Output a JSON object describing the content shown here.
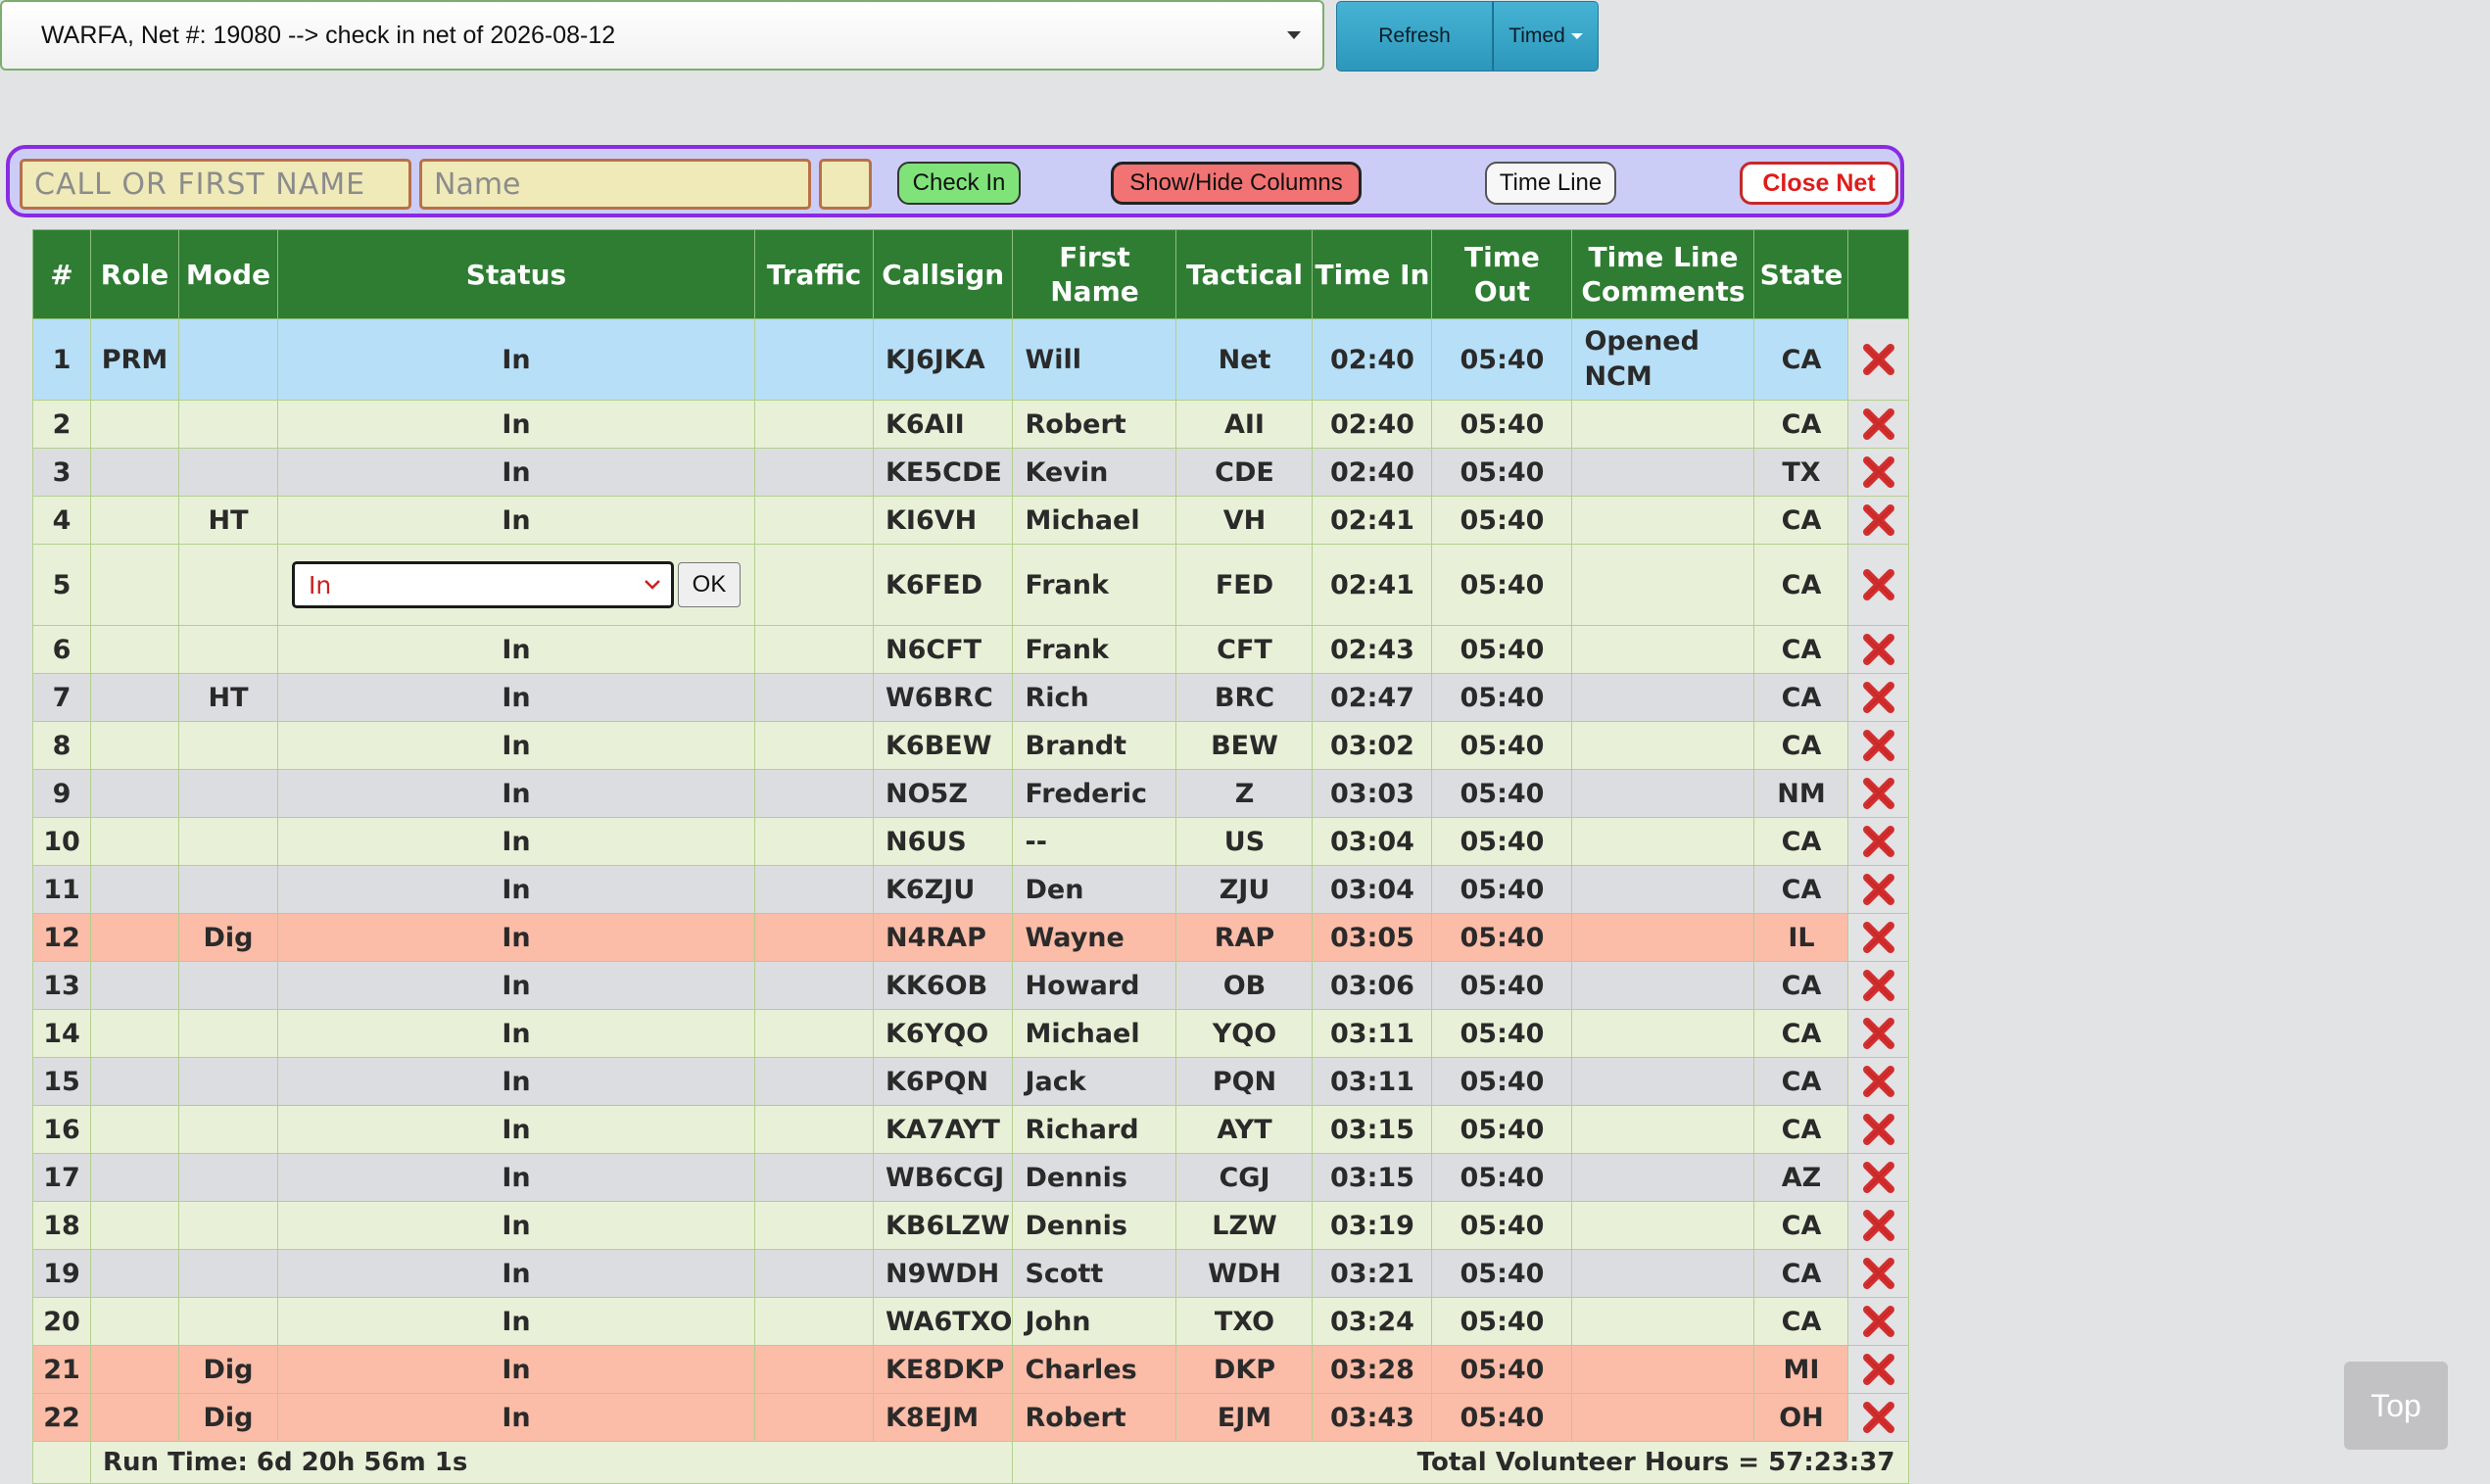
{
  "net_selector": {
    "value": "WARFA, Net #: 19080 --> check in net of 2026-08-12"
  },
  "toolbar": {
    "refresh": "Refresh",
    "timed": "Timed"
  },
  "checkin": {
    "call_placeholder": "CALL OR FIRST NAME",
    "name_placeholder": "Name",
    "check_in": "Check In",
    "show_hide": "Show/Hide Columns",
    "time_line": "Time Line",
    "close_net": "Close Net"
  },
  "columns": [
    "#",
    "Role",
    "Mode",
    "Status",
    "Traffic",
    "Callsign",
    "First Name",
    "Tactical",
    "Time In",
    "Time Out",
    "Time Line Comments",
    "State"
  ],
  "rows": [
    {
      "num": "1",
      "role": "PRM",
      "mode": "",
      "status": "In",
      "traffic": "",
      "callsign": "KJ6JKA",
      "first": "Will",
      "tactical": "Net",
      "time_in": "02:40",
      "time_out": "05:40",
      "comments": "Opened NCM",
      "state": "CA",
      "style": "prm"
    },
    {
      "num": "2",
      "role": "",
      "mode": "",
      "status": "In",
      "traffic": "",
      "callsign": "K6AII",
      "first": "Robert",
      "tactical": "AII",
      "time_in": "02:40",
      "time_out": "05:40",
      "comments": "",
      "state": "CA",
      "style": "norm"
    },
    {
      "num": "3",
      "role": "",
      "mode": "",
      "status": "In",
      "traffic": "",
      "callsign": "KE5CDE",
      "first": "Kevin",
      "tactical": "CDE",
      "time_in": "02:40",
      "time_out": "05:40",
      "comments": "",
      "state": "TX",
      "style": "alt"
    },
    {
      "num": "4",
      "role": "",
      "mode": "HT",
      "status": "In",
      "traffic": "",
      "callsign": "KI6VH",
      "first": "Michael",
      "tactical": "VH",
      "time_in": "02:41",
      "time_out": "05:40",
      "comments": "",
      "state": "CA",
      "style": "norm"
    },
    {
      "num": "5",
      "role": "",
      "mode": "",
      "status": "In",
      "traffic": "",
      "callsign": "K6FED",
      "first": "Frank",
      "tactical": "FED",
      "time_in": "02:41",
      "time_out": "05:40",
      "comments": "",
      "state": "CA",
      "style": "editing"
    },
    {
      "num": "6",
      "role": "",
      "mode": "",
      "status": "In",
      "traffic": "",
      "callsign": "N6CFT",
      "first": "Frank",
      "tactical": "CFT",
      "time_in": "02:43",
      "time_out": "05:40",
      "comments": "",
      "state": "CA",
      "style": "norm"
    },
    {
      "num": "7",
      "role": "",
      "mode": "HT",
      "status": "In",
      "traffic": "",
      "callsign": "W6BRC",
      "first": "Rich",
      "tactical": "BRC",
      "time_in": "02:47",
      "time_out": "05:40",
      "comments": "",
      "state": "CA",
      "style": "alt"
    },
    {
      "num": "8",
      "role": "",
      "mode": "",
      "status": "In",
      "traffic": "",
      "callsign": "K6BEW",
      "first": "Brandt",
      "tactical": "BEW",
      "time_in": "03:02",
      "time_out": "05:40",
      "comments": "",
      "state": "CA",
      "style": "norm"
    },
    {
      "num": "9",
      "role": "",
      "mode": "",
      "status": "In",
      "traffic": "",
      "callsign": "NO5Z",
      "first": "Frederic",
      "tactical": "Z",
      "time_in": "03:03",
      "time_out": "05:40",
      "comments": "",
      "state": "NM",
      "style": "alt"
    },
    {
      "num": "10",
      "role": "",
      "mode": "",
      "status": "In",
      "traffic": "",
      "callsign": "N6US",
      "first": "--",
      "tactical": "US",
      "time_in": "03:04",
      "time_out": "05:40",
      "comments": "",
      "state": "CA",
      "style": "norm"
    },
    {
      "num": "11",
      "role": "",
      "mode": "",
      "status": "In",
      "traffic": "",
      "callsign": "K6ZJU",
      "first": "Den",
      "tactical": "ZJU",
      "time_in": "03:04",
      "time_out": "05:40",
      "comments": "",
      "state": "CA",
      "style": "alt"
    },
    {
      "num": "12",
      "role": "",
      "mode": "Dig",
      "status": "In",
      "traffic": "",
      "callsign": "N4RAP",
      "first": "Wayne",
      "tactical": "RAP",
      "time_in": "03:05",
      "time_out": "05:40",
      "comments": "",
      "state": "IL",
      "style": "dig"
    },
    {
      "num": "13",
      "role": "",
      "mode": "",
      "status": "In",
      "traffic": "",
      "callsign": "KK6OB",
      "first": "Howard",
      "tactical": "OB",
      "time_in": "03:06",
      "time_out": "05:40",
      "comments": "",
      "state": "CA",
      "style": "alt"
    },
    {
      "num": "14",
      "role": "",
      "mode": "",
      "status": "In",
      "traffic": "",
      "callsign": "K6YQO",
      "first": "Michael",
      "tactical": "YQO",
      "time_in": "03:11",
      "time_out": "05:40",
      "comments": "",
      "state": "CA",
      "style": "norm"
    },
    {
      "num": "15",
      "role": "",
      "mode": "",
      "status": "In",
      "traffic": "",
      "callsign": "K6PQN",
      "first": "Jack",
      "tactical": "PQN",
      "time_in": "03:11",
      "time_out": "05:40",
      "comments": "",
      "state": "CA",
      "style": "alt"
    },
    {
      "num": "16",
      "role": "",
      "mode": "",
      "status": "In",
      "traffic": "",
      "callsign": "KA7AYT",
      "first": "Richard",
      "tactical": "AYT",
      "time_in": "03:15",
      "time_out": "05:40",
      "comments": "",
      "state": "CA",
      "style": "norm"
    },
    {
      "num": "17",
      "role": "",
      "mode": "",
      "status": "In",
      "traffic": "",
      "callsign": "WB6CGJ",
      "first": "Dennis",
      "tactical": "CGJ",
      "time_in": "03:15",
      "time_out": "05:40",
      "comments": "",
      "state": "AZ",
      "style": "alt"
    },
    {
      "num": "18",
      "role": "",
      "mode": "",
      "status": "In",
      "traffic": "",
      "callsign": "KB6LZW",
      "first": "Dennis",
      "tactical": "LZW",
      "time_in": "03:19",
      "time_out": "05:40",
      "comments": "",
      "state": "CA",
      "style": "norm"
    },
    {
      "num": "19",
      "role": "",
      "mode": "",
      "status": "In",
      "traffic": "",
      "callsign": "N9WDH",
      "first": "Scott",
      "tactical": "WDH",
      "time_in": "03:21",
      "time_out": "05:40",
      "comments": "",
      "state": "CA",
      "style": "alt"
    },
    {
      "num": "20",
      "role": "",
      "mode": "",
      "status": "In",
      "traffic": "",
      "callsign": "WA6TXO",
      "first": "John",
      "tactical": "TXO",
      "time_in": "03:24",
      "time_out": "05:40",
      "comments": "",
      "state": "CA",
      "style": "norm"
    },
    {
      "num": "21",
      "role": "",
      "mode": "Dig",
      "status": "In",
      "traffic": "",
      "callsign": "KE8DKP",
      "first": "Charles",
      "tactical": "DKP",
      "time_in": "03:28",
      "time_out": "05:40",
      "comments": "",
      "state": "MI",
      "style": "dig"
    },
    {
      "num": "22",
      "role": "",
      "mode": "Dig",
      "status": "In",
      "traffic": "",
      "callsign": "K8EJM",
      "first": "Robert",
      "tactical": "EJM",
      "time_in": "03:43",
      "time_out": "05:40",
      "comments": "",
      "state": "OH",
      "style": "dig"
    }
  ],
  "edit_row": {
    "status_value": "In",
    "ok": "OK"
  },
  "footer": {
    "run_time": "Run Time: 6d 20h 56m 1s",
    "volunteer_hours": "Total Volunteer Hours = 57:23:37"
  },
  "top_button": "Top",
  "icons": {
    "delete": "delete-x-icon"
  },
  "colors": {
    "header_green": "#2e7d32",
    "prm_blue": "#b7dff7",
    "dig_salmon": "#fbbca8",
    "delete_red": "#d32f2f"
  }
}
